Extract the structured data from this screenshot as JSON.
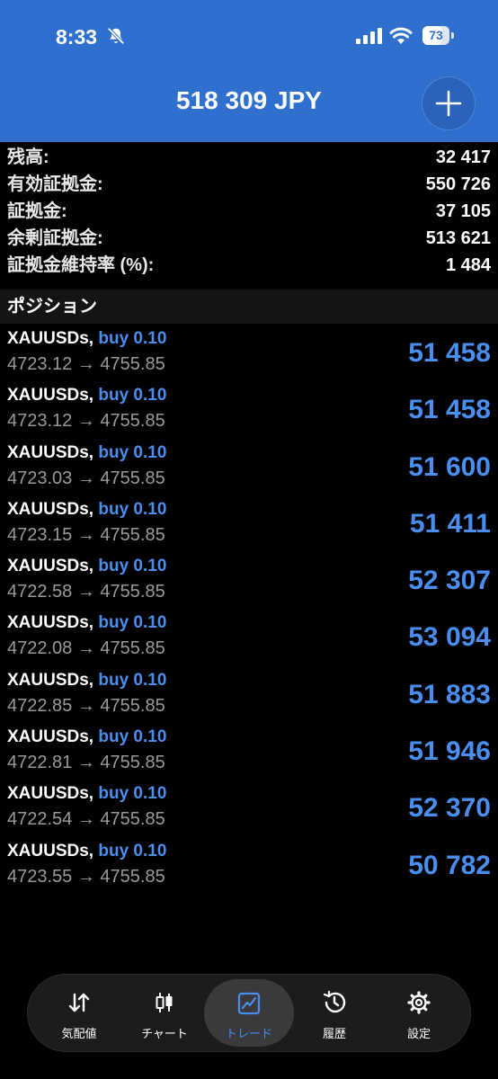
{
  "status_bar": {
    "time": "8:33",
    "battery": "73",
    "battery_level": 0.73,
    "icons": [
      "bell-slash-icon",
      "signal-icon",
      "wifi-icon",
      "battery-icon"
    ]
  },
  "header": {
    "title": "518 309 JPY",
    "add_icon": "plus-icon"
  },
  "colors": {
    "header_bg": "#2f6fcd",
    "accent_blue": "#4a8ef0",
    "background": "#000000",
    "secondary_text": "#9a9a9a"
  },
  "summary": [
    {
      "label": "残高:",
      "value": "32 417"
    },
    {
      "label": "有効証拠金:",
      "value": "550 726"
    },
    {
      "label": "証拠金:",
      "value": "37 105"
    },
    {
      "label": "余剰証拠金:",
      "value": "513 621"
    },
    {
      "label": "証拠金維持率 (%):",
      "value": "1 484"
    }
  ],
  "positions_title": "ポジション",
  "positions": [
    {
      "symbol": "XAUUSDs,",
      "side": "buy 0.10",
      "prices": "4723.12 → 4755.85",
      "profit": "51 458"
    },
    {
      "symbol": "XAUUSDs,",
      "side": "buy 0.10",
      "prices": "4723.12 → 4755.85",
      "profit": "51 458"
    },
    {
      "symbol": "XAUUSDs,",
      "side": "buy 0.10",
      "prices": "4723.03 → 4755.85",
      "profit": "51 600"
    },
    {
      "symbol": "XAUUSDs,",
      "side": "buy 0.10",
      "prices": "4723.15 → 4755.85",
      "profit": "51 411"
    },
    {
      "symbol": "XAUUSDs,",
      "side": "buy 0.10",
      "prices": "4722.58 → 4755.85",
      "profit": "52 307"
    },
    {
      "symbol": "XAUUSDs,",
      "side": "buy 0.10",
      "prices": "4722.08 → 4755.85",
      "profit": "53 094"
    },
    {
      "symbol": "XAUUSDs,",
      "side": "buy 0.10",
      "prices": "4722.85 → 4755.85",
      "profit": "51 883"
    },
    {
      "symbol": "XAUUSDs,",
      "side": "buy 0.10",
      "prices": "4722.81 → 4755.85",
      "profit": "51 946"
    },
    {
      "symbol": "XAUUSDs,",
      "side": "buy 0.10",
      "prices": "4722.54 → 4755.85",
      "profit": "52 370"
    },
    {
      "symbol": "XAUUSDs,",
      "side": "buy 0.10",
      "prices": "4723.55 → 4755.85",
      "profit": "50 782"
    }
  ],
  "tabbar": [
    {
      "label": "気配値",
      "icon": "quotes-arrows-icon",
      "active": false
    },
    {
      "label": "チャート",
      "icon": "candlestick-chart-icon",
      "active": false
    },
    {
      "label": "トレード",
      "icon": "trade-chart-icon",
      "active": true
    },
    {
      "label": "履歴",
      "icon": "history-clock-icon",
      "active": false
    },
    {
      "label": "設定",
      "icon": "settings-gear-icon",
      "active": false
    }
  ]
}
